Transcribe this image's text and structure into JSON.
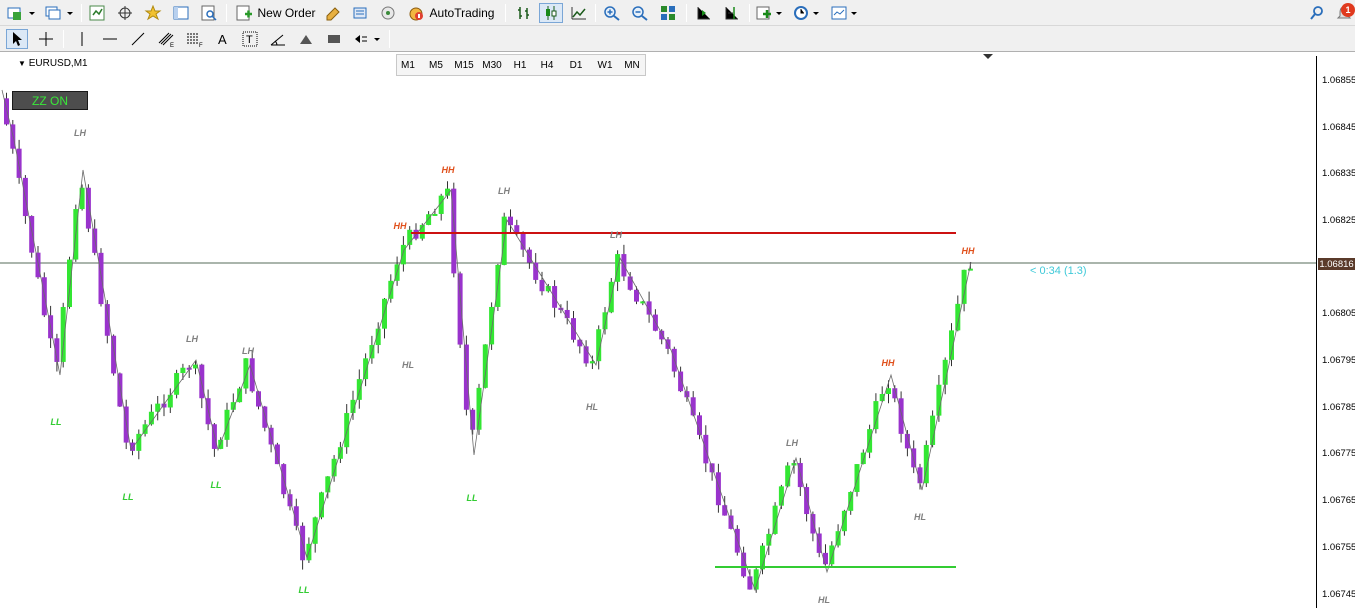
{
  "toolbar": {
    "new_order_label": "New Order",
    "autotrading_label": "AutoTrading",
    "notification_count": "1"
  },
  "timeframes": [
    "M1",
    "M5",
    "M15",
    "M30",
    "H1",
    "H4",
    "D1",
    "W1",
    "MN"
  ],
  "chart": {
    "title": "EURUSD,M1",
    "zz_button_label": "ZZ ON",
    "current_price_label": "1.06816",
    "timer_label": "< 0:34 (1.3)",
    "price_ticks": [
      "1.06855",
      "1.06845",
      "1.06835",
      "1.06825",
      "1.06815",
      "1.06805",
      "1.06795",
      "1.06785",
      "1.06775",
      "1.06765",
      "1.06755",
      "1.06745"
    ],
    "colors": {
      "bull": "#33e633",
      "bear": "#9933cc",
      "hh": "#e0501c",
      "lh_hl": "#808080",
      "ll": "#33cc33",
      "resistance_line": "#cc1111",
      "support_line": "#33cc33",
      "timer": "#3ec9d8"
    },
    "swing_labels": [
      {
        "text": "LH"
      },
      {
        "text": "LL"
      },
      {
        "text": "LL"
      },
      {
        "text": "LH"
      },
      {
        "text": "LL"
      },
      {
        "text": "LH"
      },
      {
        "text": "LL"
      },
      {
        "text": "HH"
      },
      {
        "text": "HL"
      },
      {
        "text": "HH"
      },
      {
        "text": "LL"
      },
      {
        "text": "LH"
      },
      {
        "text": "LH"
      },
      {
        "text": "HL"
      },
      {
        "text": "LH"
      },
      {
        "text": "HL"
      },
      {
        "text": "HH"
      },
      {
        "text": "HL"
      },
      {
        "text": "HH"
      }
    ]
  }
}
